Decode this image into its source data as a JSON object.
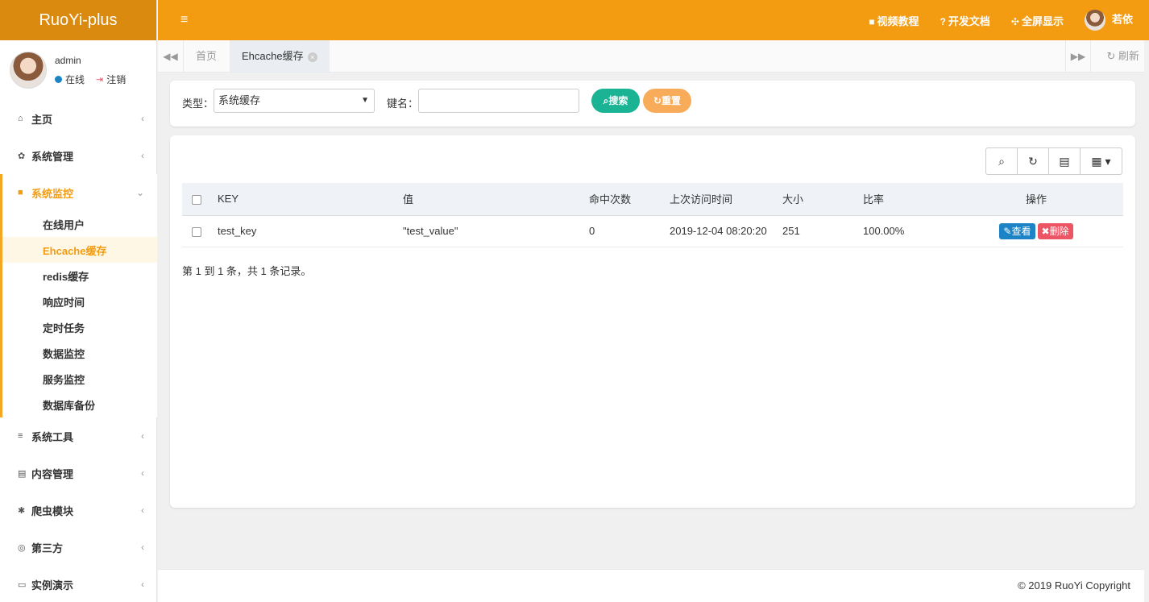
{
  "brand": "RuoYi-plus",
  "user": {
    "name": "admin",
    "status": "在线",
    "logout": "注销"
  },
  "nav": {
    "items": [
      {
        "label": "主页",
        "icon": "home-icon"
      },
      {
        "label": "系统管理",
        "icon": "gear-icon"
      }
    ],
    "active_group": {
      "label": "系统监控",
      "icon": "video-icon",
      "children": [
        "在线用户",
        "Ehcache缓存",
        "redis缓存",
        "响应时间",
        "定时任务",
        "数据监控",
        "服务监控",
        "数据库备份"
      ]
    },
    "items_after": [
      {
        "label": "系统工具",
        "icon": "bars-icon"
      },
      {
        "label": "内容管理",
        "icon": "id-card-icon"
      },
      {
        "label": "爬虫模块",
        "icon": "bug-icon"
      },
      {
        "label": "第三方",
        "icon": "life-ring-icon"
      },
      {
        "label": "实例演示",
        "icon": "desktop-icon"
      }
    ]
  },
  "topbar": {
    "video": "视频教程",
    "docs": "开发文档",
    "fullscreen": "全屏显示",
    "user": "若依"
  },
  "tabs": [
    {
      "label": "首页"
    },
    {
      "label": "Ehcache缓存"
    }
  ],
  "refresh": "刷新",
  "search": {
    "type_label": "类型：",
    "type_value": "系统缓存",
    "key_label": "键名：",
    "key_value": "",
    "search_btn": "搜索",
    "reset_btn": "重置"
  },
  "table": {
    "headers": [
      "KEY",
      "值",
      "命中次数",
      "上次访问时间",
      "大小",
      "比率",
      "操作"
    ],
    "rows": [
      {
        "key": "test_key",
        "value": "\"test_value\"",
        "hits": "0",
        "last_access": "2019-12-04 08:20:20",
        "size": "251",
        "ratio": "100.00%",
        "view": "查看",
        "delete": "删除"
      }
    ]
  },
  "pagination": "第 1 到 1 条，共 1 条记录。",
  "footer": "© 2019 RuoYi Copyright",
  "colors": {
    "accent": "#f39c12",
    "brand_bg": "#db8a10",
    "success": "#1ab394",
    "warning": "#f8ac59",
    "primary": "#1c84c6",
    "danger": "#ed5565"
  }
}
